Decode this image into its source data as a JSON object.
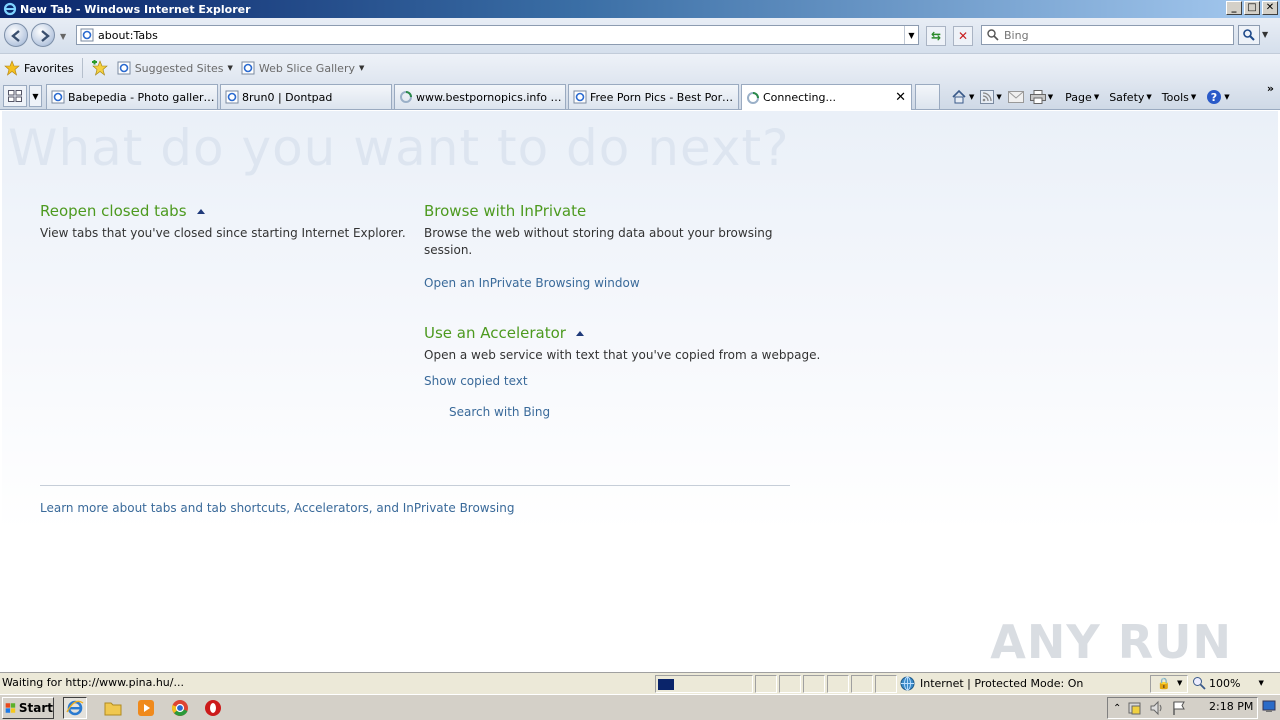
{
  "window": {
    "title": "New Tab - Windows Internet Explorer",
    "controls": {
      "minimize": "_",
      "maximize": "□",
      "close": "✕"
    }
  },
  "address": {
    "url": "about:Tabs",
    "search_placeholder": "Bing"
  },
  "favorites_bar": {
    "favorites": "Favorites",
    "suggested_sites": "Suggested Sites",
    "web_slice_gallery": "Web Slice Gallery"
  },
  "tabs": [
    {
      "label": "Babepedia - Photo galleries ...",
      "icon": "ie-page-icon"
    },
    {
      "label": "8run0 | Dontpad",
      "icon": "ie-page-icon"
    },
    {
      "label": "www.bestpornopics.info - ...",
      "icon": "loading-icon"
    },
    {
      "label": "Free Porn Pics - Best Porns...",
      "icon": "ie-page-icon"
    },
    {
      "label": "Connecting...",
      "icon": "loading-icon",
      "active": true
    }
  ],
  "command_bar": {
    "page": "Page",
    "safety": "Safety",
    "tools": "Tools"
  },
  "content": {
    "hero": "What do you want to do next?",
    "reopen": {
      "title": "Reopen closed tabs",
      "text": "View tabs that you've closed since starting Internet Explorer."
    },
    "inprivate": {
      "title": "Browse with InPrivate",
      "text": "Browse the web without storing data about your browsing session.",
      "link": "Open an InPrivate Browsing window"
    },
    "accelerator": {
      "title": "Use an Accelerator",
      "text": "Open a web service with text that you've copied from a webpage.",
      "link1": "Show copied text",
      "link2": "Search with Bing"
    },
    "footer_link": "Learn more about tabs and tab shortcuts, Accelerators, and InPrivate Browsing",
    "watermark": "ANY RUN"
  },
  "status_bar": {
    "text": "Waiting for http://www.pina.hu/...",
    "zone": "Internet | Protected Mode: On",
    "zoom": "100%"
  },
  "taskbar": {
    "start": "Start",
    "clock": "2:18 PM"
  },
  "colors": {
    "section_title": "#4d9a1f",
    "link": "#3a6a9a",
    "hero": "#dde5f0",
    "title_bar": "#0a246a"
  }
}
